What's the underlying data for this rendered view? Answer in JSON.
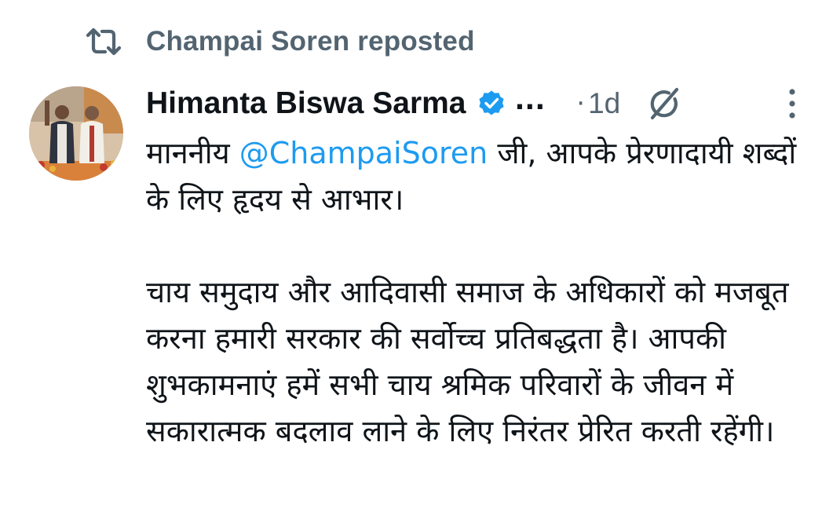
{
  "repost": {
    "icon": "repost-icon",
    "text": "Champai Soren reposted"
  },
  "tweet": {
    "author": {
      "name": "Himanta Biswa Sarma",
      "verified_icon": "verified-badge-icon",
      "name_truncation": "...",
      "avatar": "avatar"
    },
    "meta": {
      "separator": "·",
      "time": "1d"
    },
    "icons": {
      "grok": "grok-icon",
      "more": "more-options-icon"
    },
    "body": {
      "p1_before": "माननीय ",
      "p1_mention": "@ChampaiSoren",
      "p1_after": " जी, आपके प्रेरणादायी शब्दों के लिए हृदय से आभार।",
      "p2": "चाय समुदाय और आदिवासी समाज के अधिकारों को मजबूत करना हमारी सरकार की सर्वोच्च प्रतिबद्धता है। आपकी शुभकामनाएं हमें सभी चाय श्रमिक परिवारों के जीवन में सकारात्मक बदलाव लाने के लिए निरंतर प्रेरित करती रहेंगी।"
    }
  },
  "colors": {
    "text": "#0f1419",
    "secondary": "#536471",
    "accent": "#1d9bf0"
  }
}
